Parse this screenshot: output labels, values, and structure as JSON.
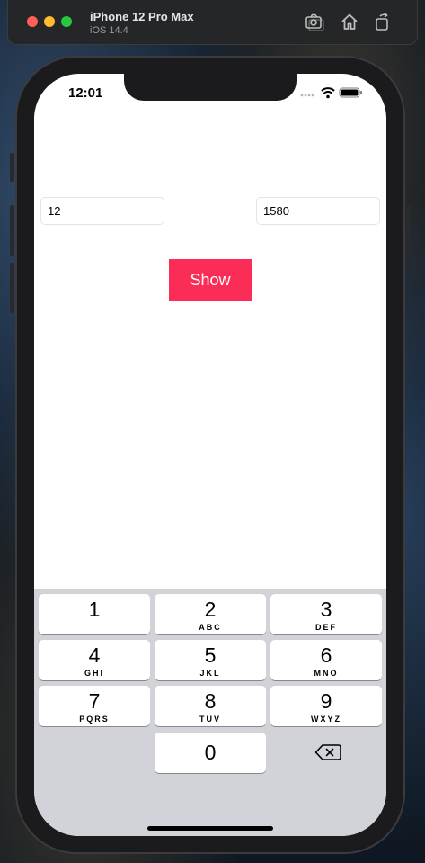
{
  "simulator": {
    "device_name": "iPhone 12 Pro Max",
    "os_version": "iOS 14.4"
  },
  "status_bar": {
    "time": "12:01"
  },
  "form": {
    "field_left_value": "12",
    "field_right_value": "1580",
    "show_button_label": "Show",
    "accent_color": "#fb2c55"
  },
  "keypad": {
    "keys": [
      {
        "num": "1",
        "letters": ""
      },
      {
        "num": "2",
        "letters": "ABC"
      },
      {
        "num": "3",
        "letters": "DEF"
      },
      {
        "num": "4",
        "letters": "GHI"
      },
      {
        "num": "5",
        "letters": "JKL"
      },
      {
        "num": "6",
        "letters": "MNO"
      },
      {
        "num": "7",
        "letters": "PQRS"
      },
      {
        "num": "8",
        "letters": "TUV"
      },
      {
        "num": "9",
        "letters": "WXYZ"
      },
      {
        "num": "0",
        "letters": ""
      }
    ],
    "delete_icon": "backspace-icon"
  }
}
